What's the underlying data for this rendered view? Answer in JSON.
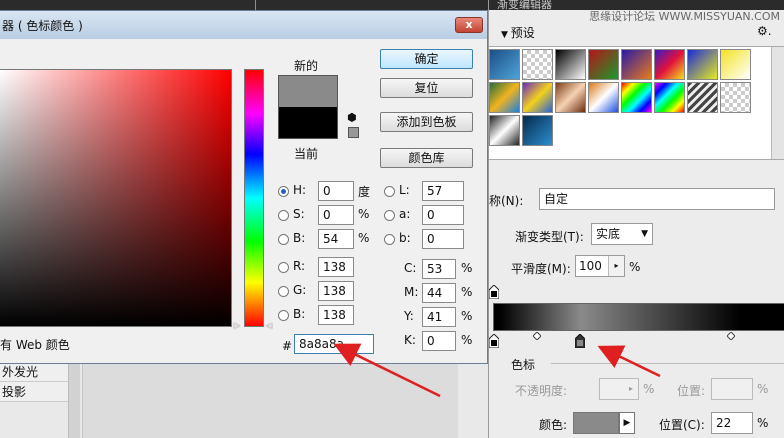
{
  "top_strip": {},
  "background_panel": {
    "layer_styles": [
      "外发光",
      "投影"
    ]
  },
  "gradient_editor": {
    "title": "渐变编辑器",
    "watermark": "思缘设计论坛 WWW.MISSYUAN.COM",
    "presets_label": "预设",
    "name_label": "称(N):",
    "name_value": "自定",
    "type_label": "渐变类型(T):",
    "type_value": "实底",
    "smooth_label": "平滑度(M):",
    "smooth_value": "100",
    "smooth_unit": "%",
    "stops_label": "色标",
    "opacity_label": "不透明度:",
    "opacity_unit": "%",
    "location_label_1": "位置:",
    "location_unit_1": "%",
    "color_label": "颜色:",
    "location_label_2": "位置(C):",
    "location_value_2": "22",
    "location_unit_2": "%",
    "stop_color": "#8a8a8a"
  },
  "picker": {
    "title": "器 ( 色标颜色 )",
    "close_label": "x",
    "new_label": "新的",
    "current_label": "当前",
    "new_color": "#8a8a8a",
    "current_color": "#000000",
    "buttons": {
      "ok": "确定",
      "reset": "复位",
      "add_to_swatches": "添加到色板",
      "color_libraries": "颜色库"
    },
    "web_colors_label": "有 Web 颜色",
    "hsb": [
      {
        "label": "H:",
        "value": "0",
        "unit": "度"
      },
      {
        "label": "S:",
        "value": "0",
        "unit": "%"
      },
      {
        "label": "B:",
        "value": "54",
        "unit": "%"
      }
    ],
    "lab": [
      {
        "label": "L:",
        "value": "57"
      },
      {
        "label": "a:",
        "value": "0"
      },
      {
        "label": "b:",
        "value": "0"
      }
    ],
    "rgb": [
      {
        "label": "R:",
        "value": "138"
      },
      {
        "label": "G:",
        "value": "138"
      },
      {
        "label": "B:",
        "value": "138"
      }
    ],
    "cmyk": [
      {
        "label": "C:",
        "value": "53",
        "unit": "%"
      },
      {
        "label": "M:",
        "value": "44",
        "unit": "%"
      },
      {
        "label": "Y:",
        "value": "41",
        "unit": "%"
      },
      {
        "label": "K:",
        "value": "0",
        "unit": "%"
      }
    ],
    "hex_label": "#",
    "hex_value": "8a8a8a"
  },
  "colors": {
    "annotation": "#e02020",
    "accent": "#3c7fb1"
  }
}
